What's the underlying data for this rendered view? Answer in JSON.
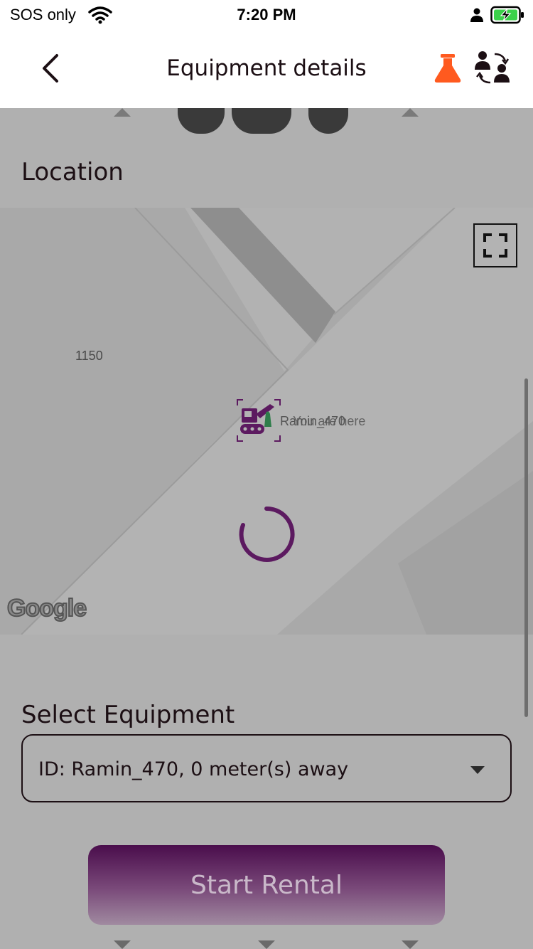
{
  "status_bar": {
    "carrier": "SOS only",
    "time": "7:20 PM",
    "icons": [
      "wifi-icon",
      "person-icon",
      "battery-charging-icon"
    ],
    "battery_color": "#3bd14a"
  },
  "nav": {
    "title": "Equipment details",
    "icons": [
      "back-chevron-icon",
      "flask-icon",
      "swap-users-icon"
    ],
    "flask_color": "#ff5a1f"
  },
  "location": {
    "title": "Location"
  },
  "map": {
    "street_label": "1150",
    "marker_label": "Ramin_470",
    "you_label": "You are here",
    "attribution": "Google",
    "icons": [
      "fullscreen-icon",
      "excavator-marker-icon",
      "loading-spinner-icon"
    ],
    "accent": "#5c1a60"
  },
  "select_equipment": {
    "title": "Select Equipment",
    "selected": "ID: Ramin_470, 0 meter(s) away"
  },
  "start_button": {
    "label": "Start Rental"
  }
}
